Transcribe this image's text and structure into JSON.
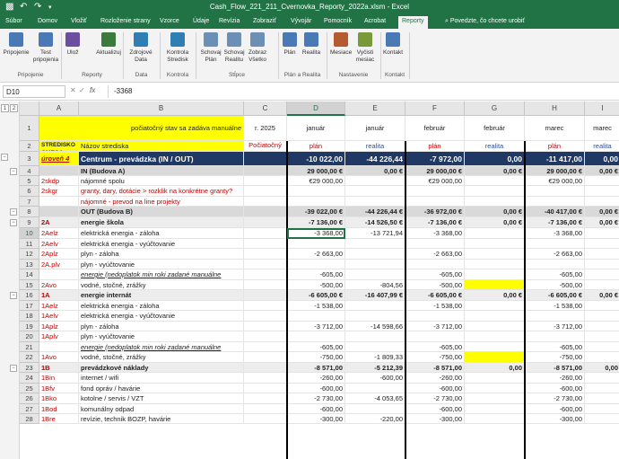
{
  "window": {
    "title": "Cash_Flow_221_211_Cvernovka_Reporty_2022a.xlsm - Excel"
  },
  "tabs": [
    "Súbor",
    "Domov",
    "Vložiť",
    "Rozloženie strany",
    "Vzorce",
    "Údaje",
    "Revízia",
    "Zobraziť",
    "Vývojár",
    "Pomocník",
    "Acrobat",
    "Reporty"
  ],
  "tell_me": "Povedzte, čo chcete urobiť",
  "ribbon": {
    "buttons": [
      {
        "label": "Pripojenie",
        "label2": ""
      },
      {
        "label": "Test",
        "label2": "pripojenia"
      },
      {
        "label": "Ulož",
        "label2": ""
      },
      {
        "label": "Aktualizuj",
        "label2": ""
      },
      {
        "label": "Zdrojové",
        "label2": "Data"
      },
      {
        "label": "Kontrola",
        "label2": "Stredisk"
      },
      {
        "label": "Schovaj",
        "label2": "Plán"
      },
      {
        "label": "Schovaj",
        "label2": "Realitu"
      },
      {
        "label": "Zobraz",
        "label2": "Všetko"
      },
      {
        "label": "Plán",
        "label2": ""
      },
      {
        "label": "Realita",
        "label2": ""
      },
      {
        "label": "Mesiace",
        "label2": ""
      },
      {
        "label": "Vyčisti",
        "label2": "mesiac"
      },
      {
        "label": "Kontakt",
        "label2": ""
      }
    ],
    "groups": [
      "Pripojenie",
      "Reporty",
      "Data",
      "Kontrola",
      "Stĺpce",
      "Plán a Realita",
      "Nastavenie",
      "Kontakt"
    ],
    "icon_colors": [
      "#4a7ab5",
      "#4a7ab5",
      "#6b4ea0",
      "#3a7a3a",
      "#2f7fb5",
      "#2f7fb5",
      "#6b8fb5",
      "#6b8fb5",
      "#6b8fb5",
      "#4a7ab5",
      "#4a7ab5",
      "#b55b2f",
      "#7a9a3a",
      "#4a7ab5"
    ]
  },
  "formula_bar": {
    "name_box": "D10",
    "fx": "fx",
    "value": "-3368"
  },
  "columns": [
    "A",
    "B",
    "C",
    "D",
    "E",
    "F",
    "G",
    "H",
    "I"
  ],
  "rows": [
    {
      "n": "1",
      "a": "",
      "b": "počiatočný stav sa zadáva manuálne",
      "c": "r. 2025",
      "d": "január",
      "e": "január",
      "f": "február",
      "g": "február",
      "h": "marec",
      "i": "marec"
    },
    {
      "n": "2",
      "a": "STREDISKO OMEGA",
      "b": "Názov strediska",
      "c": "Počiatočný stav",
      "d": "plán",
      "e": "realita",
      "f": "plán",
      "g": "realita",
      "h": "plán",
      "i": "realita"
    },
    {
      "n": "3",
      "a": "úroveň 4",
      "b": "Centrum - prevádzka (IN / OUT)",
      "c": "",
      "d": "-10 022,00",
      "e": "-44 226,44",
      "f": "-7 972,00",
      "g": "0,00",
      "h": "-11 417,00",
      "i": "0,00"
    },
    {
      "n": "4",
      "a": "",
      "b": "IN (Budova A)",
      "c": "",
      "d": "29 000,00 €",
      "e": "0,00 €",
      "f": "29 000,00 €",
      "g": "0,00 €",
      "h": "29 000,00 €",
      "i": "0,00 €"
    },
    {
      "n": "5",
      "a": "2skdp",
      "b": "nájomné spolu",
      "c": "",
      "d": "€29 000,00",
      "e": "",
      "f": "€29 000,00",
      "g": "",
      "h": "€29 000,00",
      "i": ""
    },
    {
      "n": "6",
      "a": "2skgr",
      "b": "granty, dary, dotácie > rozklik na konkrétne granty?",
      "c": "",
      "d": "",
      "e": "",
      "f": "",
      "g": "",
      "h": "",
      "i": ""
    },
    {
      "n": "7",
      "a": "",
      "b": "nájomné - prevod na line projekty",
      "c": "",
      "d": "",
      "e": "",
      "f": "",
      "g": "",
      "h": "",
      "i": ""
    },
    {
      "n": "8",
      "a": "",
      "b": "OUT (Budova B)",
      "c": "",
      "d": "-39 022,00 €",
      "e": "-44 226,44 €",
      "f": "-36 972,00 €",
      "g": "0,00 €",
      "h": "-40 417,00 €",
      "i": "0,00 €"
    },
    {
      "n": "9",
      "a": "2A",
      "b": "energie škola",
      "c": "",
      "d": "-7 136,00 €",
      "e": "-14 526,50 €",
      "f": "-7 136,00 €",
      "g": "0,00 €",
      "h": "-7 136,00 €",
      "i": "0,00 €"
    },
    {
      "n": "10",
      "a": "2Aelz",
      "b": "elektrická energia - záloha",
      "c": "",
      "d": "-3 368,00",
      "e": "-13 721,94",
      "f": "-3 368,00",
      "g": "",
      "h": "-3 368,00",
      "i": ""
    },
    {
      "n": "11",
      "a": "2Aelv",
      "b": "elektrická energia - vyúčtovanie",
      "c": "",
      "d": "",
      "e": "",
      "f": "",
      "g": "",
      "h": "",
      "i": ""
    },
    {
      "n": "12",
      "a": "2Aplz",
      "b": "plyn - záloha",
      "c": "",
      "d": "-2 663,00",
      "e": "",
      "f": "-2 663,00",
      "g": "",
      "h": "-2 663,00",
      "i": ""
    },
    {
      "n": "13",
      "a": "2A.plv",
      "b": "plyn - vyúčtovanie",
      "c": "",
      "d": "",
      "e": "",
      "f": "",
      "g": "",
      "h": "",
      "i": ""
    },
    {
      "n": "14",
      "a": "",
      "b": "energie (nedoplatok min roki zadané manuálne",
      "c": "",
      "d": "-605,00",
      "e": "",
      "f": "-605,00",
      "g": "",
      "h": "-605,00",
      "i": ""
    },
    {
      "n": "15",
      "a": "2Avo",
      "b": "vodné, stočné, zrážky",
      "c": "",
      "d": "-500,00",
      "e": "-804,56",
      "f": "-500,00",
      "g": "",
      "h": "-500,00",
      "i": ""
    },
    {
      "n": "16",
      "a": "1A",
      "b": "energie internát",
      "c": "",
      "d": "-6 605,00 €",
      "e": "-16 407,99 €",
      "f": "-6 605,00 €",
      "g": "0,00 €",
      "h": "-6 605,00 €",
      "i": "0,00 €"
    },
    {
      "n": "17",
      "a": "1Aelz",
      "b": "elektrická energia - záloha",
      "c": "",
      "d": "-1 538,00",
      "e": "",
      "f": "-1 538,00",
      "g": "",
      "h": "-1 538,00",
      "i": ""
    },
    {
      "n": "18",
      "a": "1Aelv",
      "b": "elektrická energia - vyúčtovanie",
      "c": "",
      "d": "",
      "e": "",
      "f": "",
      "g": "",
      "h": "",
      "i": ""
    },
    {
      "n": "19",
      "a": "1Aplz",
      "b": "plyn - záloha",
      "c": "",
      "d": "-3 712,00",
      "e": "-14 598,66",
      "f": "-3 712,00",
      "g": "",
      "h": "-3 712,00",
      "i": ""
    },
    {
      "n": "20",
      "a": "1Aplv",
      "b": "plyn - vyúčtovanie",
      "c": "",
      "d": "",
      "e": "",
      "f": "",
      "g": "",
      "h": "",
      "i": ""
    },
    {
      "n": "21",
      "a": "",
      "b": "energie (nedoplatok min roki zadané manuálne",
      "c": "",
      "d": "-605,00",
      "e": "",
      "f": "-605,00",
      "g": "",
      "h": "-605,00",
      "i": ""
    },
    {
      "n": "22",
      "a": "1Avo",
      "b": "vodné, stočné, zrážky",
      "c": "",
      "d": "-750,00",
      "e": "-1 809,33",
      "f": "-750,00",
      "g": "",
      "h": "-750,00",
      "i": ""
    },
    {
      "n": "23",
      "a": "1B",
      "b": "prevádzkové náklady",
      "c": "",
      "d": "-8 571,00",
      "e": "-5 212,39",
      "f": "-8 571,00",
      "g": "0,00",
      "h": "-8 571,00",
      "i": "0,00"
    },
    {
      "n": "24",
      "a": "1Bin",
      "b": "internet / wifi",
      "c": "",
      "d": "-260,00",
      "e": "-600,00",
      "f": "-260,00",
      "g": "",
      "h": "-260,00",
      "i": ""
    },
    {
      "n": "25",
      "a": "1Bfv",
      "b": "fond opráv / havárie",
      "c": "",
      "d": "-600,00",
      "e": "",
      "f": "-600,00",
      "g": "",
      "h": "-600,00",
      "i": ""
    },
    {
      "n": "26",
      "a": "1Bko",
      "b": "kotolne / servis / VZT",
      "c": "",
      "d": "-2 730,00",
      "e": "-4 053,65",
      "f": "-2 730,00",
      "g": "",
      "h": "-2 730,00",
      "i": ""
    },
    {
      "n": "27",
      "a": "1Bod",
      "b": "komunálny odpad",
      "c": "",
      "d": "-600,00",
      "e": "",
      "f": "-600,00",
      "g": "",
      "h": "-600,00",
      "i": ""
    },
    {
      "n": "28",
      "a": "1Bre",
      "b": "revízie, technik BOZP, havárie",
      "c": "",
      "d": "-300,00",
      "e": "-220,00",
      "f": "-300,00",
      "g": "",
      "h": "-300,00",
      "i": ""
    }
  ],
  "colors": {
    "brand": "#217346",
    "navy": "#1f3864",
    "yellow": "#ffff00",
    "red": "#c00000",
    "blue": "#2e4ea0"
  }
}
